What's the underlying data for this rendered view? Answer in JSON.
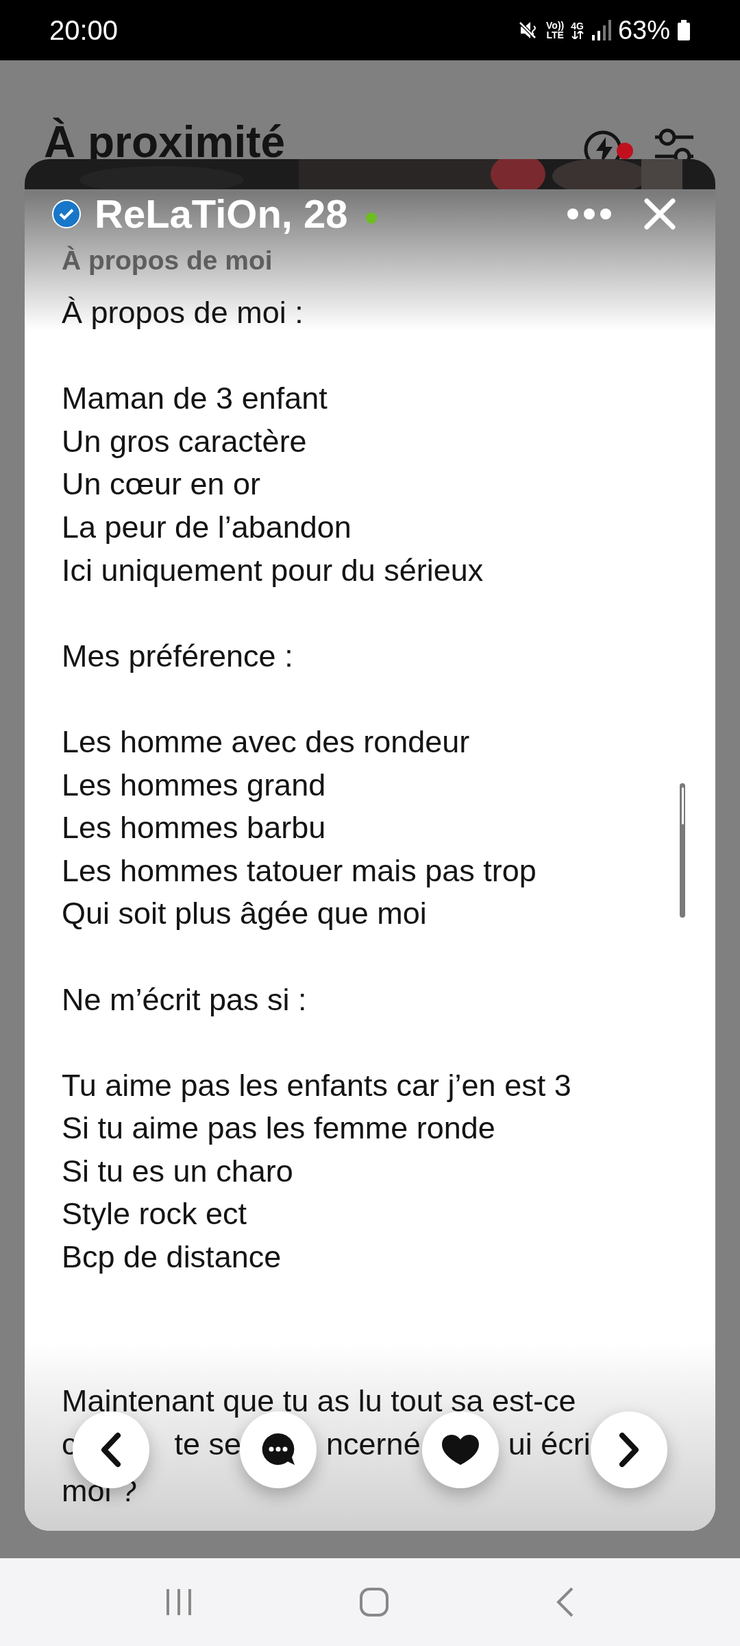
{
  "status_bar": {
    "time": "20:00",
    "volte_top": "Vo))",
    "volte_bottom": "LTE",
    "network": "4G",
    "battery": "63%"
  },
  "background": {
    "title": "À proximité",
    "notification": true
  },
  "profile": {
    "name": "ReLaTiOn, 28",
    "verified": true,
    "online": true,
    "section": "À propos de moi",
    "paragraphs": [
      [
        "À propos de moi :"
      ],
      [
        "Maman de 3 enfant",
        "Un gros caractère",
        "Un cœur en or",
        "La peur de l’abandon",
        "Ici uniquement pour du sérieux"
      ],
      [
        "Mes préférence :"
      ],
      [
        "Les homme avec des rondeur",
        "Les hommes grand",
        "Les hommes barbu",
        "Les hommes tatouer mais pas trop",
        "Qui soit plus âgée que moi"
      ],
      [
        "Ne m’écrit pas si :"
      ],
      [
        "Tu aime pas les enfants car j’en est 3",
        "Si tu aime pas les femme ronde",
        "Si tu es un charo",
        "Style rock ect",
        "Bcp de distance"
      ]
    ],
    "last_paragraph": {
      "line_1": "Maintenant que tu as lu tout sa est-ce",
      "line_2_fragments": [
        "c",
        "te se",
        "ncerné",
        "ui écri"
      ],
      "line_3": "moi ?"
    }
  }
}
